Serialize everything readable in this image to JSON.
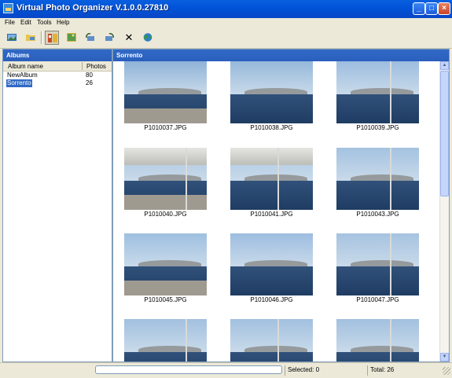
{
  "window": {
    "title": "Virtual Photo Organizer V.1.0.0.27810"
  },
  "title_buttons": {
    "minimize": "_",
    "maximize": "□",
    "close": "×"
  },
  "menu": [
    "File",
    "Edit",
    "Tools",
    "Help"
  ],
  "toolbar": {
    "icons": [
      "new-album-icon",
      "open-folder-icon",
      "view-thumbnails-icon",
      "view-photos-icon",
      "rotate-left-icon",
      "rotate-right-icon",
      "delete-icon",
      "web-globe-icon"
    ],
    "delete_glyph": "✕"
  },
  "albums_panel": {
    "title": "Albums",
    "columns": [
      "Album name",
      "Photos"
    ],
    "rows": [
      {
        "name": "NewAlbum",
        "count": "80"
      },
      {
        "name": "Sorrento",
        "count": "26",
        "selected": true
      }
    ]
  },
  "photos_panel": {
    "title": "Sorrento",
    "photos": [
      {
        "file": "P1010037.JPG",
        "scene": "boat-deck"
      },
      {
        "file": "P1010038.JPG",
        "scene": "coast"
      },
      {
        "file": "P1010039.JPG",
        "scene": "coast-pole"
      },
      {
        "file": "P1010040.JPG",
        "scene": "awning-deck"
      },
      {
        "file": "P1010041.JPG",
        "scene": "awning-sea"
      },
      {
        "file": "P1010043.JPG",
        "scene": "sea-pole"
      },
      {
        "file": "P1010045.JPG",
        "scene": "vesuvius-rail"
      },
      {
        "file": "P1010046.JPG",
        "scene": "vesuvius"
      },
      {
        "file": "P1010047.JPG",
        "scene": "vesuvius-pole"
      },
      {
        "file": "",
        "scene": "partial"
      },
      {
        "file": "",
        "scene": "partial"
      },
      {
        "file": "",
        "scene": "partial"
      }
    ]
  },
  "status": {
    "selected": "Selected: 0",
    "total": "Total: 26"
  },
  "colors": {
    "title_bar": "#0053d6",
    "panel_header": "#3169c6",
    "selection": "#316ac5",
    "window_bg": "#ece9d8"
  }
}
